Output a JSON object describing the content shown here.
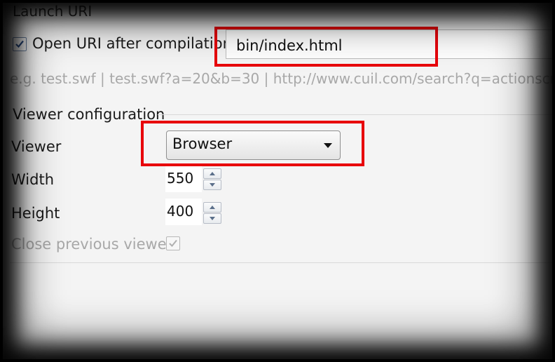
{
  "launch": {
    "section_title": "Launch URI",
    "open_uri_label": "Open URI after compilation",
    "open_uri_checked": true,
    "uri_value": "bin/index.html",
    "hint": "e.g. test.swf | test.swf?a=20&b=30 | http://www.cuil.com/search?q=actionscrip"
  },
  "viewer": {
    "section_title": "Viewer configuration",
    "viewer_label": "Viewer",
    "viewer_value": "Browser",
    "width_label": "Width",
    "width_value": "550",
    "height_label": "Height",
    "height_value": "400",
    "close_previous_label": "Close previous viewer",
    "close_previous_checked": true
  },
  "colors": {
    "highlight": "#e8000b",
    "panel_bg": "#f4f4f4"
  }
}
